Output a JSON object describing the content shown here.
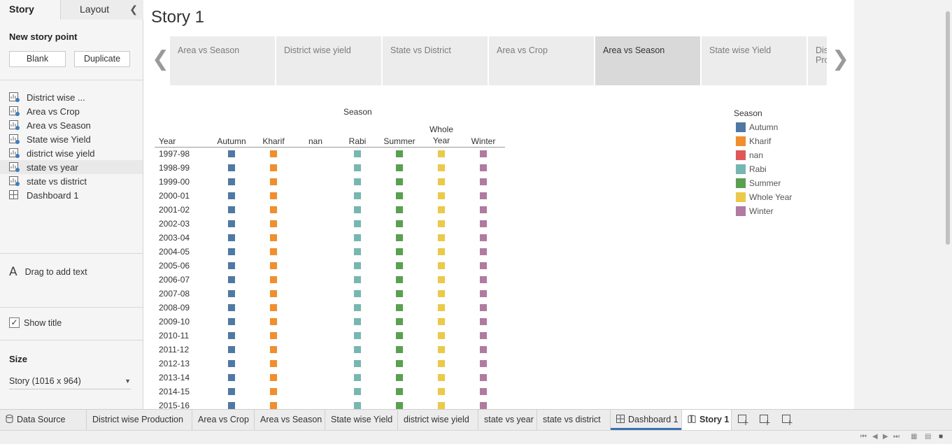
{
  "left_panel": {
    "tabs": {
      "story": "Story",
      "layout": "Layout"
    },
    "new_story_point": "New story point",
    "blank_button": "Blank",
    "duplicate_button": "Duplicate",
    "sheets": [
      {
        "label": "District wise ...",
        "icon": "sheet-icon"
      },
      {
        "label": "Area vs  Crop",
        "icon": "sheet-icon"
      },
      {
        "label": "Area vs Season",
        "icon": "sheet-icon"
      },
      {
        "label": "State wise Yield",
        "icon": "sheet-icon"
      },
      {
        "label": "district wise yield",
        "icon": "sheet-icon"
      },
      {
        "label": "state vs year",
        "icon": "sheet-icon"
      },
      {
        "label": "state vs district",
        "icon": "sheet-icon"
      },
      {
        "label": "Dashboard 1",
        "icon": "dashboard-icon"
      }
    ],
    "drag_text": "Drag to add text",
    "show_title": "Show title",
    "show_title_checked": true,
    "size_label": "Size",
    "size_value": "Story (1016 x 964)"
  },
  "main": {
    "story_title": "Story 1",
    "story_points": [
      {
        "label": "Area vs Season",
        "active": false
      },
      {
        "label": "District wise yield",
        "active": false
      },
      {
        "label": "State vs District",
        "active": false
      },
      {
        "label": "Area vs Crop",
        "active": false
      },
      {
        "label": "Area vs Season",
        "active": true
      },
      {
        "label": "State wise Yield",
        "active": false
      },
      {
        "label": "Dis\nPro",
        "active": false
      }
    ],
    "table": {
      "season_header": "Season",
      "year_header": "Year",
      "columns": [
        "Autumn",
        "Kharif",
        "nan",
        "Rabi",
        "Summer",
        "Whole\nYear",
        "Winter"
      ],
      "years": [
        "1997-98",
        "1998-99",
        "1999-00",
        "2000-01",
        "2001-02",
        "2002-03",
        "2003-04",
        "2004-05",
        "2005-06",
        "2006-07",
        "2007-08",
        "2008-09",
        "2009-10",
        "2010-11",
        "2011-12",
        "2012-13",
        "2013-14",
        "2014-15",
        "2015-16"
      ],
      "column_has_marks": [
        true,
        true,
        false,
        true,
        true,
        true,
        true
      ]
    },
    "legend": {
      "title": "Season",
      "items": [
        {
          "label": "Autumn",
          "color": "#4e79a7"
        },
        {
          "label": "Kharif",
          "color": "#f28e2b"
        },
        {
          "label": "nan",
          "color": "#e15759"
        },
        {
          "label": "Rabi",
          "color": "#76b7b2"
        },
        {
          "label": "Summer",
          "color": "#59a14f"
        },
        {
          "label": "Whole Year",
          "color": "#edc948"
        },
        {
          "label": "Winter",
          "color": "#b07aa1"
        }
      ]
    }
  },
  "bottom_tabs": [
    {
      "label": "Data Source",
      "icon": "database-icon"
    },
    {
      "label": "District wise Production"
    },
    {
      "label": "Area vs  Crop"
    },
    {
      "label": "Area vs Season"
    },
    {
      "label": "State wise Yield"
    },
    {
      "label": "district wise yield"
    },
    {
      "label": "state vs year"
    },
    {
      "label": "state vs district"
    },
    {
      "label": "Dashboard 1",
      "icon": "dashboard-icon"
    },
    {
      "label": "Story 1",
      "icon": "story-icon",
      "active": true
    }
  ]
}
